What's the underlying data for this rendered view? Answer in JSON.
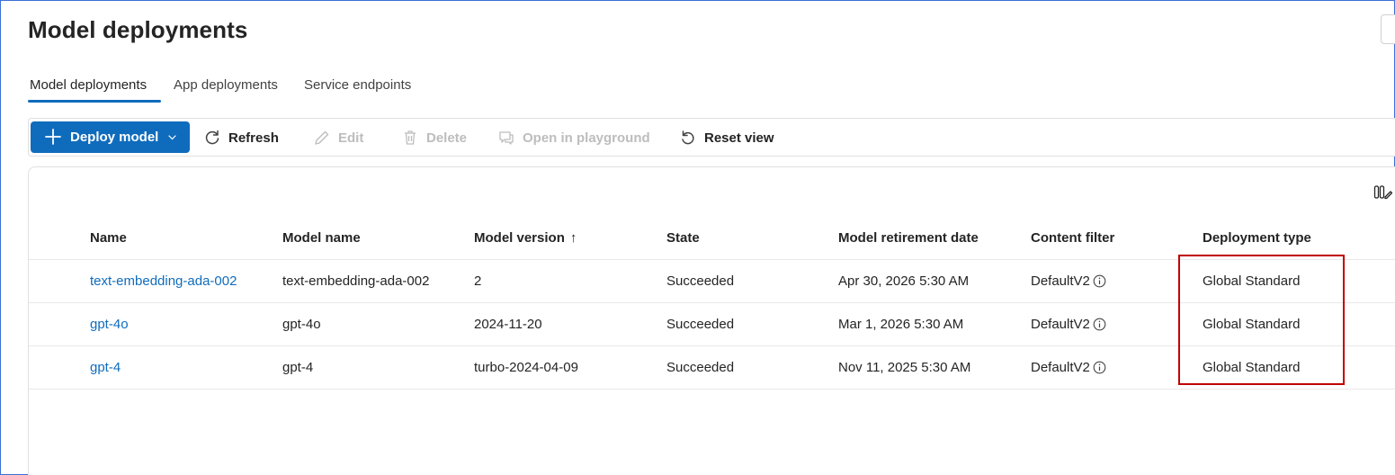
{
  "page": {
    "title": "Model deployments"
  },
  "tabs": [
    {
      "label": "Model deployments",
      "active": true
    },
    {
      "label": "App deployments",
      "active": false
    },
    {
      "label": "Service endpoints",
      "active": false
    }
  ],
  "toolbar": {
    "deploy_label": "Deploy model",
    "refresh_label": "Refresh",
    "edit_label": "Edit",
    "delete_label": "Delete",
    "playground_label": "Open in playground",
    "reset_label": "Reset view"
  },
  "table": {
    "columns": [
      "Name",
      "Model name",
      "Model version",
      "State",
      "Model retirement date",
      "Content filter",
      "Deployment type"
    ],
    "sort_indicator": "↑",
    "rows": [
      {
        "name": "text-embedding-ada-002",
        "model_name": "text-embedding-ada-002",
        "model_version": "2",
        "state": "Succeeded",
        "retirement_date": "Apr 30, 2026 5:30 AM",
        "content_filter": "DefaultV2",
        "deployment_type": "Global Standard"
      },
      {
        "name": "gpt-4o",
        "model_name": "gpt-4o",
        "model_version": "2024-11-20",
        "state": "Succeeded",
        "retirement_date": "Mar 1, 2026 5:30 AM",
        "content_filter": "DefaultV2",
        "deployment_type": "Global Standard"
      },
      {
        "name": "gpt-4",
        "model_name": "gpt-4",
        "model_version": "turbo-2024-04-09",
        "state": "Succeeded",
        "retirement_date": "Nov 11, 2025 5:30 AM",
        "content_filter": "DefaultV2",
        "deployment_type": "Global Standard"
      }
    ]
  },
  "colors": {
    "accent": "#0f6cbd",
    "highlight": "#c00000",
    "disabled": "#bdbdbd"
  }
}
